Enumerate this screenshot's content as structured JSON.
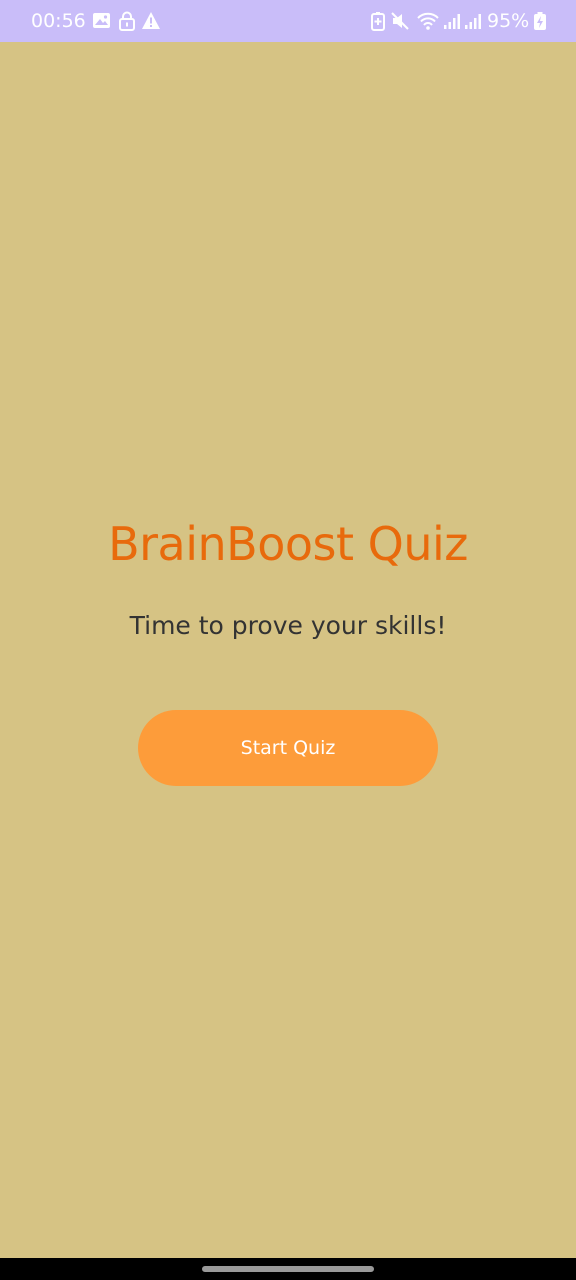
{
  "status_bar": {
    "time": "00:56",
    "battery": "95%",
    "icons": [
      "image-icon",
      "lock-icon",
      "warning-icon",
      "battery-saver-icon",
      "mute-icon",
      "wifi-icon",
      "signal-icon",
      "signal-icon",
      "charging-icon"
    ]
  },
  "main": {
    "title": "BrainBoost Quiz",
    "subtitle": "Time to prove your skills!",
    "start_button_label": "Start Quiz"
  },
  "colors": {
    "background": "#d6c384",
    "status_bar": "#c9bdf9",
    "title": "#e86a0c",
    "button": "#fd9c3a"
  }
}
